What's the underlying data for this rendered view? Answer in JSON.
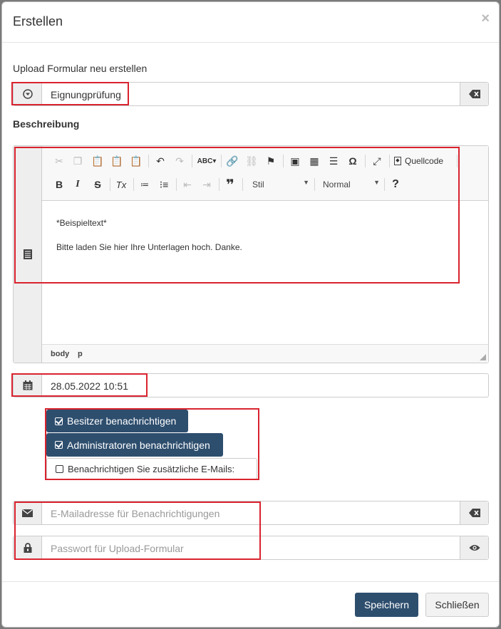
{
  "dialog": {
    "title": "Erstellen",
    "close_glyph": "×"
  },
  "upload": {
    "label": "Upload Formular neu erstellen",
    "value": "Eignungprüfung",
    "icon": "circle-down-icon",
    "clear_icon": "backspace-icon"
  },
  "description": {
    "label": "Beschreibung",
    "toolbar": {
      "source_label": "Quellcode",
      "style_label": "Stil",
      "format_label": "Normal",
      "bold": "B",
      "italic": "I",
      "strike": "S",
      "clear_format": "Tx",
      "blockquote": "❞",
      "special_char": "Ω",
      "help": "?"
    },
    "content": {
      "line1": "*Beispieltext*",
      "line2": "Bitte laden Sie hier Ihre Unterlagen hoch. Danke."
    },
    "statusbar": {
      "path1": "body",
      "path2": "p"
    }
  },
  "date": {
    "value": "28.05.2022 10:51",
    "icon": "calendar-icon"
  },
  "notifications": {
    "owner_label": "Besitzer benachrichtigen",
    "admins_label": "Administratoren benachrichtigen",
    "extra_label": "Benachrichtigen Sie zusätzliche E-Mails:"
  },
  "email": {
    "placeholder": "E-Mailadresse für Benachrichtigungen",
    "icon": "envelope-icon",
    "clear_icon": "backspace-icon"
  },
  "password": {
    "placeholder": "Passwort für Upload-Formular",
    "icon": "lock-icon",
    "toggle_icon": "eye-icon"
  },
  "footer": {
    "save_label": "Speichern",
    "close_label": "Schließen"
  },
  "colors": {
    "primary": "#2e4e6e",
    "highlight": "#d9232e",
    "addon_bg": "#eeeeee"
  }
}
